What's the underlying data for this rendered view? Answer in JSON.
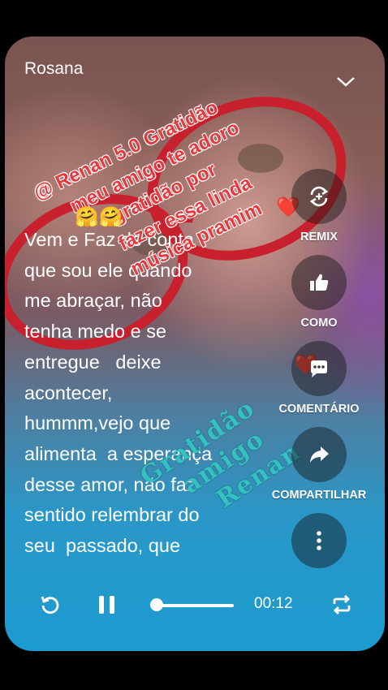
{
  "post": {
    "author": "Rosana",
    "lyrics": "Vem e Faz de conta\nque sou ele quando\nme abraçar, não\ntenha medo e se\nentregue   deixe\nacontecer,\nhummm,vejo que\nalimenta  a esperança\ndesse amor, não faz\nsentido relembrar do\nseu  passado, que"
  },
  "overlay": {
    "red_text": "@ Renan 5.0 Gratidão\n     meu amigo te adoro\n           gratidão por\n          fazer essa linda\n          música pramim",
    "teal_text": "Gratidão\n   amigo\n     Renan",
    "emoji_left": "🤗🤗",
    "emoji_heart": "❤️"
  },
  "actions": [
    {
      "name": "remix",
      "label": "REMIX",
      "icon": "remix-icon"
    },
    {
      "name": "like",
      "label": "COMO",
      "icon": "thumbs-up-icon"
    },
    {
      "name": "comment",
      "label": "COMENTÁRIO",
      "icon": "comment-icon"
    },
    {
      "name": "share",
      "label": "COMPARTILHAR",
      "icon": "share-icon"
    },
    {
      "name": "more",
      "label": "",
      "icon": "more-vertical-icon"
    }
  ],
  "player": {
    "time": "00:12",
    "progress": 0.05,
    "icons": [
      "replay-icon",
      "pause-icon",
      "repeat-icon"
    ]
  },
  "colors": {
    "overlay_red": "#e8383d",
    "overlay_teal": "#35c1c0",
    "player_blue": "#1c9bd0"
  }
}
